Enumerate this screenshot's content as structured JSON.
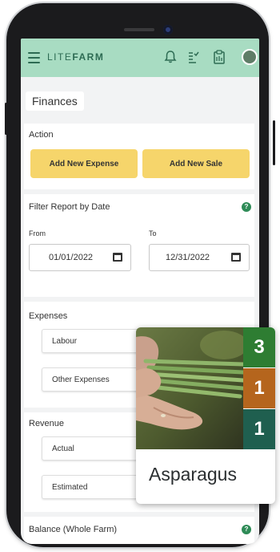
{
  "header": {
    "logo_lite": "LITE",
    "logo_farm": "FARM",
    "icons": [
      "menu-icon",
      "bell-icon",
      "task-icon",
      "clipboard-icon",
      "avatar"
    ]
  },
  "page_title": "Finances",
  "action": {
    "label": "Action",
    "add_expense": "Add New Expense",
    "add_sale": "Add New Sale"
  },
  "filter": {
    "title": "Filter Report by Date",
    "from_label": "From",
    "from_value": "01/01/2022",
    "to_label": "To",
    "to_value": "12/31/2022"
  },
  "expenses": {
    "label": "Expenses",
    "items": [
      "Labour",
      "Other Expenses"
    ]
  },
  "revenue": {
    "label": "Revenue",
    "items": [
      "Actual",
      "Estimated"
    ]
  },
  "balance": {
    "label": "Balance (Whole Farm)"
  },
  "crop_card": {
    "name": "Asparagus",
    "badges": [
      {
        "value": "3",
        "color": "#2e7d32"
      },
      {
        "value": "1",
        "color": "#b5651d"
      },
      {
        "value": "1",
        "color": "#1f5f4f"
      }
    ]
  },
  "colors": {
    "header": "#a8dcc2",
    "accent_yellow": "#f6d56b",
    "green": "#2e8b57"
  }
}
